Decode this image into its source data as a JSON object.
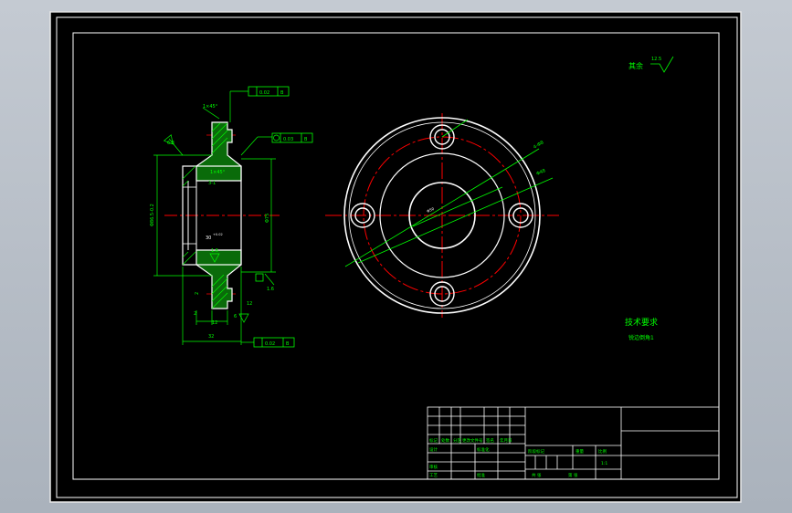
{
  "colors": {
    "background": "#000000",
    "outline": "#ffffff",
    "centerline": "#ff0000",
    "dimension": "#00ff00",
    "hatch": "#00ff00",
    "frame_surround": "#b8bfc8"
  },
  "notes": {
    "surface_roughness": "其余",
    "roughness_value": "12.5",
    "tech_requirements_title": "技术要求",
    "tech_requirements_body": "锐边倒角1"
  },
  "side_view": {
    "chamfer_top": "1×45°",
    "chamfer_mid": "1×45°",
    "datum_a_tolerance": "0.02",
    "datum_a_label": "B",
    "datum_b_tolerance": "0.03",
    "datum_b_label": "B",
    "datum_c_tolerance": "0.02",
    "datum_c_label": "B",
    "outer_dia": "Φ86.5-0.2",
    "inner_dia": "Φ75",
    "bore_callout": "3-1",
    "bore_depth": "30",
    "bore_fit": "+0.02",
    "roughness_side": "1.6",
    "roughness_bottom": "1.6",
    "roughness_left": "6.3",
    "small_dim_1": "2",
    "small_dim_2": "12",
    "small_dim_3": "2",
    "width_dim": "32",
    "angle_dim": "12",
    "step_dim": "6"
  },
  "front_view": {
    "hole_callout_1": "4-Φ8",
    "hole_callout_2": "Φ48",
    "center_label": "Φ50"
  },
  "title_block": {
    "row_labels": [
      "标记",
      "处数",
      "分区",
      "更改文件号",
      "签名",
      "年月日"
    ],
    "design_label": "设计",
    "standard_label": "标准化",
    "stage_label": "阶段标记",
    "weight_label": "重量",
    "scale_label": "比例",
    "review_label": "审核",
    "process_label": "工艺",
    "approve_label": "批准",
    "sheet_label": "共  张",
    "page_label": "第  张",
    "scale_value": "1:1"
  }
}
